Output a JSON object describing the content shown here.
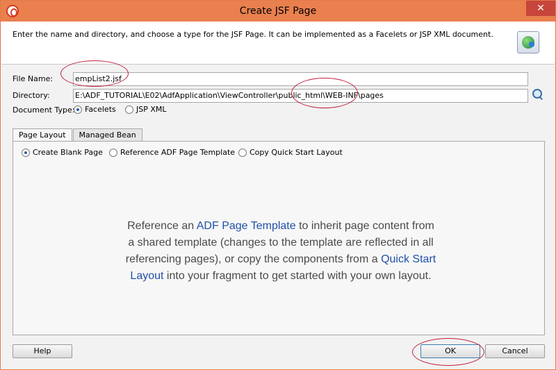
{
  "window": {
    "title": "Create JSF Page",
    "close_glyph": "✕"
  },
  "header": {
    "description": "Enter the name and directory, and choose a type for the JSF Page. It can be implemented as a Facelets or JSP XML document."
  },
  "form": {
    "file_name_label": "File Name:",
    "file_name_value": "empList2.jsf",
    "directory_label": "Directory:",
    "directory_value": "E:\\ADF_TUTORIAL\\E02\\AdfApplication\\ViewController\\public_html\\WEB-INF\\pages",
    "document_type_label": "Document Type:",
    "doc_types": [
      {
        "label": "Facelets",
        "selected": true
      },
      {
        "label": "JSP XML",
        "selected": false
      }
    ]
  },
  "tabs": [
    {
      "label": "Page Layout",
      "active": true
    },
    {
      "label": "Managed Bean",
      "active": false
    }
  ],
  "layout_options": [
    {
      "label": "Create Blank Page",
      "selected": true
    },
    {
      "label": "Reference ADF Page Template",
      "selected": false
    },
    {
      "label": "Copy Quick Start Layout",
      "selected": false
    }
  ],
  "info": {
    "part1": "Reference an ",
    "link1": "ADF Page Template",
    "part2": " to inherit page content from a shared template (changes to the template are reflected in all referencing pages), or copy the components from a ",
    "link2": "Quick Start Layout",
    "part3": " into your fragment to get started with your own layout."
  },
  "buttons": {
    "help": "Help",
    "ok": "OK",
    "cancel": "Cancel"
  },
  "colors": {
    "titlebar": "#e9804e",
    "annotation": "#c0203a",
    "link": "#2050a8"
  }
}
